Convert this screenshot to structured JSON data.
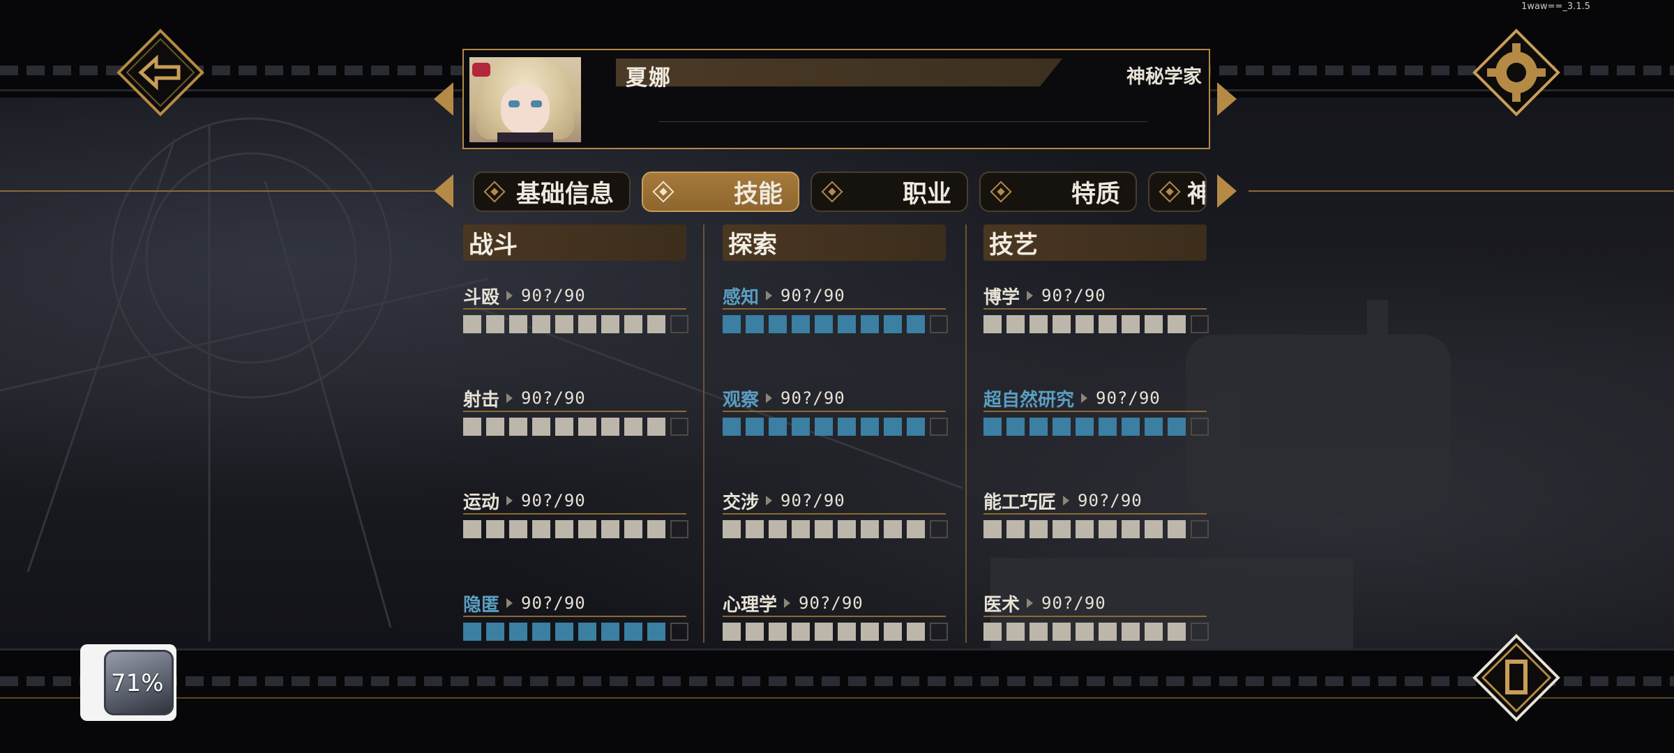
{
  "version": "1waw==_3.1.5",
  "character": {
    "name": "夏娜",
    "class": "神秘学家"
  },
  "tabs": [
    {
      "label": "基础信息",
      "active": false
    },
    {
      "label": "技能",
      "active": true
    },
    {
      "label": "职业",
      "active": false
    },
    {
      "label": "特质",
      "active": false
    },
    {
      "label": "神",
      "active": false
    }
  ],
  "columns": [
    {
      "title": "战斗",
      "skills": [
        {
          "name": "斗殴",
          "value": "90?/90",
          "filled": 9,
          "total": 10,
          "highlight": false
        },
        {
          "name": "射击",
          "value": "90?/90",
          "filled": 9,
          "total": 10,
          "highlight": false
        },
        {
          "name": "运动",
          "value": "90?/90",
          "filled": 9,
          "total": 10,
          "highlight": false
        },
        {
          "name": "隐匿",
          "value": "90?/90",
          "filled": 9,
          "total": 10,
          "highlight": true
        }
      ]
    },
    {
      "title": "探索",
      "skills": [
        {
          "name": "感知",
          "value": "90?/90",
          "filled": 9,
          "total": 10,
          "highlight": true
        },
        {
          "name": "观察",
          "value": "90?/90",
          "filled": 9,
          "total": 10,
          "highlight": true
        },
        {
          "name": "交涉",
          "value": "90?/90",
          "filled": 9,
          "total": 10,
          "highlight": false
        },
        {
          "name": "心理学",
          "value": "90?/90",
          "filled": 9,
          "total": 10,
          "highlight": false
        }
      ]
    },
    {
      "title": "技艺",
      "skills": [
        {
          "name": "博学",
          "value": "90?/90",
          "filled": 9,
          "total": 10,
          "highlight": false
        },
        {
          "name": "超自然研究",
          "value": "90?/90",
          "filled": 9,
          "total": 10,
          "highlight": true
        },
        {
          "name": "能工巧匠",
          "value": "90?/90",
          "filled": 9,
          "total": 10,
          "highlight": false
        },
        {
          "name": "医术",
          "value": "90?/90",
          "filled": 9,
          "total": 10,
          "highlight": false
        }
      ]
    }
  ],
  "progress": {
    "label": "71%",
    "value": 71
  },
  "icons": {
    "back": "back-arrow-icon",
    "settings": "gear-icon",
    "bottom_right": "book-icon"
  },
  "colors": {
    "gold": "#b48a45",
    "skill_blue": "#3b7fa3",
    "pip": "#bdb6aa"
  }
}
